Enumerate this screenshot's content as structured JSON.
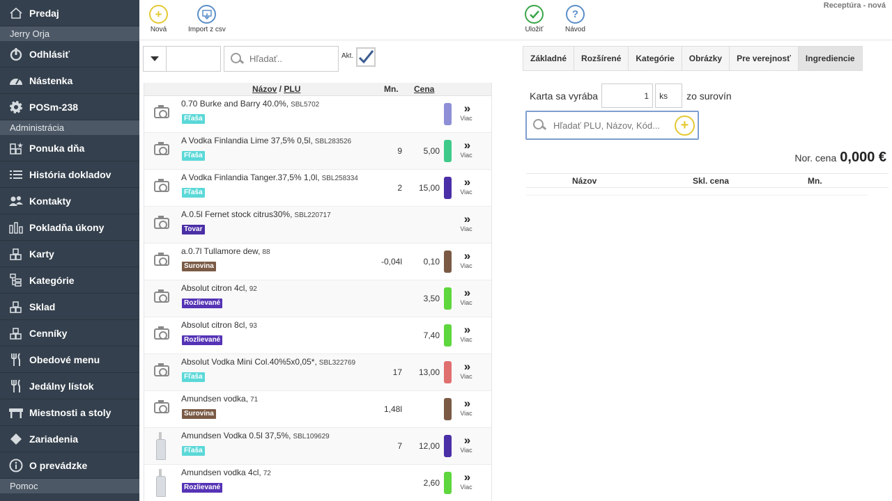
{
  "sidebar": {
    "top_item": {
      "label": "Predaj",
      "icon": "home-icon"
    },
    "user_name": "Jerry Orja",
    "logout": {
      "label": "Odhlásiť",
      "icon": "power-icon"
    },
    "dashboard": {
      "label": "Nástenka",
      "icon": "gauge-icon"
    },
    "device": {
      "label": "POSm-238",
      "icon": "gear-icon"
    },
    "admin_section": "Administrácia",
    "items": [
      {
        "label": "Ponuka dňa",
        "icon": "star-boxes-icon"
      },
      {
        "label": "História dokladov",
        "icon": "list-icon"
      },
      {
        "label": "Kontakty",
        "icon": "people-icon"
      },
      {
        "label": "Pokladňa úkony",
        "icon": "bar-chart-icon"
      },
      {
        "label": "Karty",
        "icon": "boxes-icon"
      },
      {
        "label": "Kategórie",
        "icon": "tree-icon"
      },
      {
        "label": "Sklad",
        "icon": "boxes-icon"
      },
      {
        "label": "Cenníky",
        "icon": "boxes-icon"
      },
      {
        "label": "Obedové menu",
        "icon": "cutlery-icon"
      },
      {
        "label": "Jedálny lístok",
        "icon": "cutlery-icon"
      },
      {
        "label": "Miestnosti a stoly",
        "icon": "table-icon"
      },
      {
        "label": "Zariadenia",
        "icon": "diamond-icon"
      },
      {
        "label": "O prevádzke",
        "icon": "info-icon"
      }
    ],
    "help_section": "Pomoc"
  },
  "toolbar": {
    "new_label": "Nová",
    "import_label": "Import z csv",
    "save_label": "Uložiť",
    "help_label": "Návod",
    "page_title": "Receptúra - nová"
  },
  "filters": {
    "search_placeholder": "Hľadať..",
    "akt_label": "Akt."
  },
  "list": {
    "header": {
      "name": "Názov",
      "sep": " / ",
      "plu": "PLU",
      "qty": "Mn.",
      "price": "Cena"
    },
    "more_label": "Viac",
    "rows": [
      {
        "name": "0.70 Burke and Barry 40.0%,",
        "code": "SBL5702",
        "badge": "Fľaša",
        "badge_color": "#5bd8d8",
        "qty": "",
        "price": "",
        "color": "#8e8fd6",
        "image": "camera"
      },
      {
        "name": "A Vodka Finlandia Lime 37,5% 0,5l,",
        "code": "SBL283526",
        "badge": "Fľaša",
        "badge_color": "#5bd8d8",
        "qty": "9",
        "price": "5,00",
        "color": "#3fca8a",
        "image": "camera"
      },
      {
        "name": "A Vodka Finlandia Tanger.37,5% 1,0l,",
        "code": "SBL258334",
        "badge": "Fľaša",
        "badge_color": "#5bd8d8",
        "qty": "2",
        "price": "15,00",
        "color": "#4b2fa6",
        "image": "camera"
      },
      {
        "name": "A.0.5l Fernet stock citrus30%,",
        "code": "SBL220717",
        "badge": "Tovar",
        "badge_color": "#4b2fa6",
        "qty": "",
        "price": "",
        "color": "",
        "image": "camera"
      },
      {
        "name": "a.0.7l Tullamore dew,",
        "code": "88",
        "badge": "Surovina",
        "badge_color": "#7a5a45",
        "qty": "-0,04l",
        "price": "0,10",
        "color": "#7a5a45",
        "image": "camera"
      },
      {
        "name": "Absolut citron 4cl,",
        "code": "92",
        "badge": "Rozlievané",
        "badge_color": "#5533b5",
        "qty": "",
        "price": "3,50",
        "color": "#5ed63d",
        "image": "camera"
      },
      {
        "name": "Absolut citron 8cl,",
        "code": "93",
        "badge": "Rozlievané",
        "badge_color": "#5533b5",
        "qty": "",
        "price": "7,40",
        "color": "#5ed63d",
        "image": "camera"
      },
      {
        "name": "Absolut Vodka Mini Col.40%5x0,05*,",
        "code": "SBL322769",
        "badge": "Fľaša",
        "badge_color": "#5bd8d8",
        "qty": "17",
        "price": "13,00",
        "color": "#e07070",
        "image": "camera"
      },
      {
        "name": "Amundsen vodka,",
        "code": "71",
        "badge": "Surovina",
        "badge_color": "#7a5a45",
        "qty": "1,48l",
        "price": "",
        "color": "#7a5a45",
        "image": "camera"
      },
      {
        "name": "Amundsen Vodka 0.5l 37,5%,",
        "code": "SBL109629",
        "badge": "Fľaša",
        "badge_color": "#5bd8d8",
        "qty": "7",
        "price": "12,00",
        "color": "#4b2fa6",
        "image": "bottle"
      },
      {
        "name": "Amundsen vodka 4cl,",
        "code": "72",
        "badge": "Rozlievané",
        "badge_color": "#5533b5",
        "qty": "",
        "price": "2,60",
        "color": "#5ed63d",
        "image": "bottle"
      }
    ]
  },
  "detail": {
    "tabs": [
      "Základné",
      "Rozšírené",
      "Kategórie",
      "Obrázky",
      "Pre verejnosť",
      "Ingrediencie"
    ],
    "active_tab": 5,
    "produce_prefix": "Karta sa vyrába",
    "produce_count": "1",
    "produce_unit": "ks",
    "produce_suffix": "zo surovín",
    "search_placeholder": "Hľadať PLU, Názov, Kód...",
    "nor_cena_label": "Nor. cena",
    "nor_cena_value": "0,000 €",
    "table_headers": {
      "name": "Názov",
      "price": "Skl. cena",
      "qty": "Mn."
    }
  },
  "colors": {
    "sidebar_bg": "#34404d",
    "new_icon": "#e5c933",
    "import_icon": "#5b8fc9",
    "save_icon": "#3aa64a",
    "help_icon": "#5b8fc9"
  }
}
